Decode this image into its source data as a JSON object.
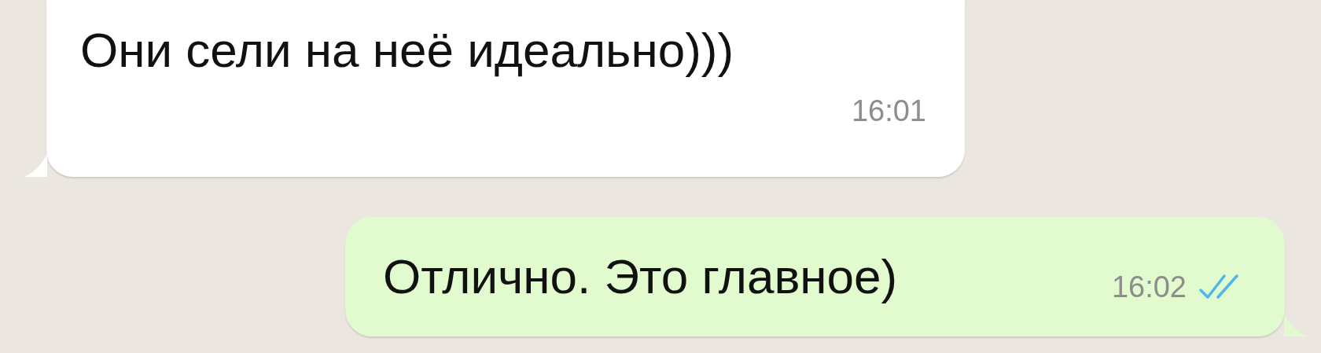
{
  "messages": [
    {
      "kind": "incoming",
      "text": "Они сели на неё идеально)))",
      "time": "16:01"
    },
    {
      "kind": "outgoing",
      "text": "Отлично. Это главное)",
      "time": "16:02",
      "read": true
    }
  ]
}
